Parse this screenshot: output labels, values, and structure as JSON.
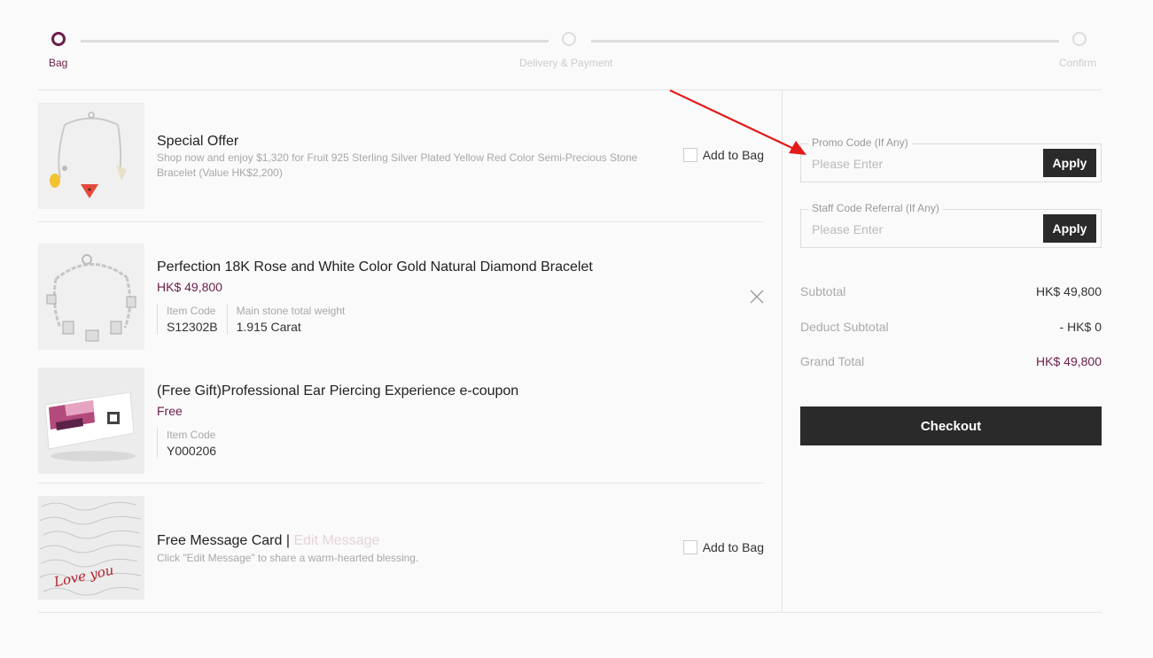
{
  "stepper": {
    "steps": [
      {
        "label": "Bag"
      },
      {
        "label": "Delivery & Payment"
      },
      {
        "label": "Confirm"
      }
    ]
  },
  "items": {
    "offer": {
      "title": "Special Offer",
      "desc": "Shop now and enjoy $1,320 for Fruit 925 Sterling Silver Plated Yellow Red Color Semi-Precious Stone Bracelet (Value HK$2,200)",
      "add_label": "Add to Bag"
    },
    "bracelet": {
      "title": "Perfection 18K Rose and White Color Gold Natural Diamond Bracelet",
      "price": "HK$ 49,800",
      "code_key": "Item Code",
      "code_val": "S12302B",
      "weight_key": "Main stone total weight",
      "weight_val": "1.915 Carat"
    },
    "gift": {
      "title": "(Free Gift)Professional Ear Piercing Experience e-coupon",
      "price": "Free",
      "code_key": "Item Code",
      "code_val": "Y000206"
    },
    "card": {
      "title": "Free Message Card |",
      "edit": "Edit Message",
      "desc": "Click \"Edit Message\" to share a warm-hearted blessing.",
      "add_label": "Add to Bag",
      "card_text": "Love you"
    }
  },
  "promo": {
    "legend": "Promo Code (If Any)",
    "placeholder": "Please Enter",
    "apply": "Apply"
  },
  "staff": {
    "legend": "Staff Code Referral (If Any)",
    "placeholder": "Please Enter",
    "apply": "Apply"
  },
  "summary": {
    "subtotal_label": "Subtotal",
    "subtotal_val": "HK$ 49,800",
    "deduct_label": "Deduct Subtotal",
    "deduct_val": "- HK$ 0",
    "grand_label": "Grand Total",
    "grand_val": "HK$ 49,800"
  },
  "checkout_label": "Checkout",
  "colors": {
    "accent": "#6b1e4a",
    "dark": "#2a2a2a",
    "annotation": "#e31b1b"
  }
}
